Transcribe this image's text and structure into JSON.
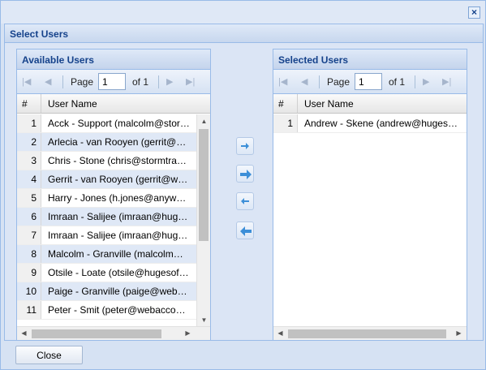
{
  "dialog": {
    "title": "Select Users",
    "close_label": "Close"
  },
  "available": {
    "title": "Available Users",
    "pager": {
      "page_label": "Page",
      "page_value": "1",
      "of_label": "of 1"
    },
    "columns": {
      "num": "#",
      "name": "User Name"
    },
    "rows": [
      {
        "num": "1",
        "name": "Acck - Support (malcolm@stormtrader.com)"
      },
      {
        "num": "2",
        "name": "Arlecia - van Rooyen (gerrit@webaccounting.co.za)"
      },
      {
        "num": "3",
        "name": "Chris - Stone (chris@stormtrader.com)"
      },
      {
        "num": "4",
        "name": "Gerrit - van Rooyen (gerrit@webaccounting.co.za)"
      },
      {
        "num": "5",
        "name": "Harry - Jones (h.jones@anywhere.com)"
      },
      {
        "num": "6",
        "name": "Imraan - Salijee (imraan@hugesoftware.com)"
      },
      {
        "num": "7",
        "name": "Imraan - Salijee (imraan@hugesoftware.com)"
      },
      {
        "num": "8",
        "name": "Malcolm - Granville (malcolm@stormtrader.com)"
      },
      {
        "num": "9",
        "name": "Otsile - Loate (otsile@hugesoftware.com)"
      },
      {
        "num": "10",
        "name": "Paige - Granville (paige@webaccounting.co.za)"
      },
      {
        "num": "11",
        "name": "Peter - Smit (peter@webaccounting.co.za)"
      }
    ]
  },
  "selected": {
    "title": "Selected Users",
    "pager": {
      "page_label": "Page",
      "page_value": "1",
      "of_label": "of 1"
    },
    "columns": {
      "num": "#",
      "name": "User Name"
    },
    "rows": [
      {
        "num": "1",
        "name": "Andrew - Skene (andrew@hugesoft..."
      }
    ]
  },
  "actions": {
    "add_selected_icon": "arrow-right-small-icon",
    "add_all_icon": "arrow-right-large-icon",
    "remove_selected_icon": "arrow-left-small-icon",
    "remove_all_icon": "arrow-left-large-icon"
  },
  "colors": {
    "header_text": "#15428b",
    "border": "#99bbe8",
    "accent_arrow": "#3d8fd8"
  }
}
